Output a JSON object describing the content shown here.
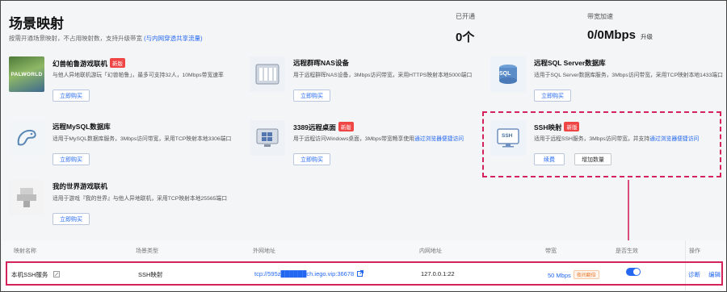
{
  "header": {
    "title": "场景映射",
    "description": "按需开通场景映射，不占用映射数，支持升级带宽",
    "description_link": "(与内网穿透共享流量)",
    "stat_opened_label": "已开通",
    "stat_opened_value": "0个",
    "stat_bandwidth_label": "带宽加速",
    "stat_bandwidth_value": "0/0Mbps",
    "stat_upgrade_link": "升级"
  },
  "cards": {
    "palworld": {
      "title": "幻兽帕鲁游戏联机",
      "badge": "新版",
      "desc": "与他人异地联机游玩「幻兽帕鲁」，最多可支持32人，10Mbps带宽速率",
      "button": "立即购买",
      "logo_text": "PALWORLD"
    },
    "nas": {
      "title": "远程群晖NAS设备",
      "desc": "用于远程群晖NAS设备，3Mbps访问带宽，采用HTTPS映射本地5000端口",
      "button": "立即购买"
    },
    "sqlserver": {
      "title": "远程SQL Server数据库",
      "desc": "适用于SQL Server数据库服务，3Mbps访问带宽，采用TCP映射本地1433端口",
      "button": "立即购买",
      "icon_text": "SQL"
    },
    "mysql": {
      "title": "远程MySQL数据库",
      "desc": "适用于MySQL数据库服务，3Mbps访问带宽，采用TCP映射本地3306端口",
      "button": "立即购买"
    },
    "rdp": {
      "title": "3389远程桌面",
      "badge": "新版",
      "desc": "用于远程访问Windows桌面，3Mbps带宽畅享使用",
      "desc_link": "通过浏览器便捷访问",
      "button": "立即购买"
    },
    "ssh": {
      "title": "SSH映射",
      "badge": "新版",
      "desc": "适用于远程SSH服务，3Mbps访问带宽，并支持",
      "desc_link": "通过浏览器便捷访问",
      "button_renew": "续费",
      "button_add": "增加数量",
      "icon_text": "SSH"
    },
    "minecraft": {
      "title": "我的世界游戏联机",
      "desc": "适用于游戏『我的世界』与他人异地联机，采用TCP映射本地25565端口",
      "button": "立即购买"
    }
  },
  "table": {
    "headers": [
      "映射名称",
      "场景类型",
      "外网地址",
      "内网地址",
      "带宽",
      "是否生效",
      "操作"
    ],
    "row": {
      "name": "本机SSH服务",
      "type": "SSH映射",
      "public_addr": "tcp://595z██████ch.iego.vip:36678",
      "private_addr": "127.0.0.1:22",
      "bandwidth": "50 Mbps",
      "bandwidth_tag": "夜间翻倍",
      "enabled": true,
      "action_diagnose": "诊断",
      "action_edit": "编辑"
    }
  },
  "colors": {
    "accent": "#2468f2",
    "highlight": "#d4225a",
    "badge": "#f04545"
  }
}
